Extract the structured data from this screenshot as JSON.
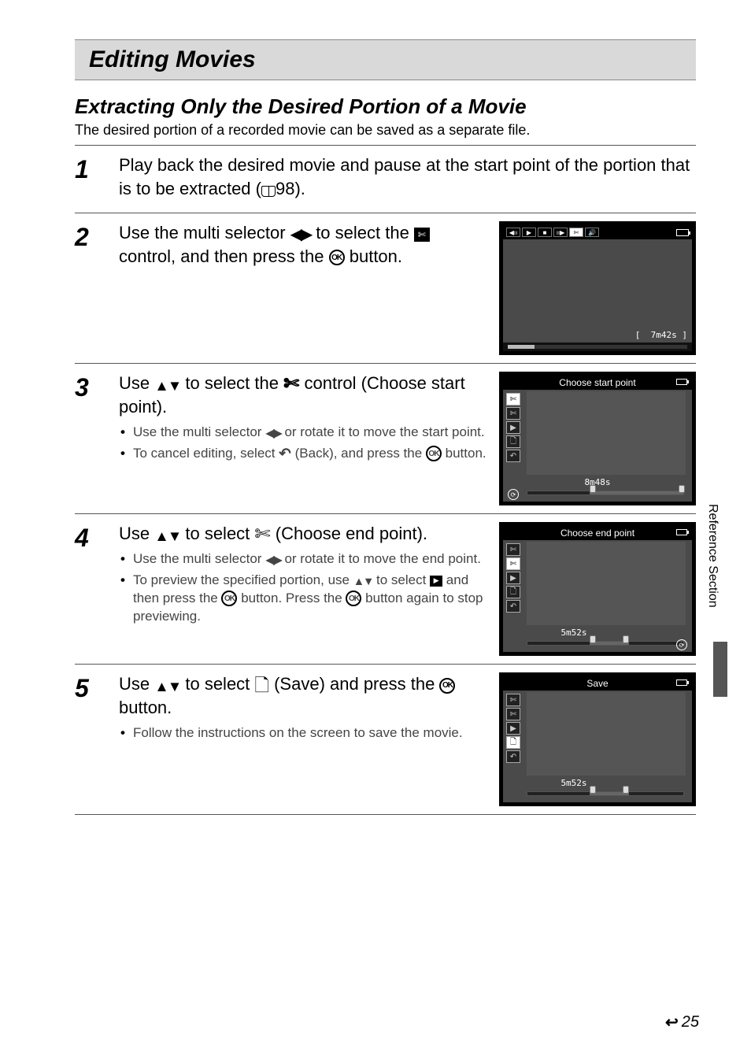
{
  "title": "Editing Movies",
  "subtitle": "Extracting Only the Desired Portion of a Movie",
  "intro": "The desired portion of a recorded movie can be saved as a separate file.",
  "side_label": "Reference Section",
  "page_number": "25",
  "steps": {
    "s1": {
      "num": "1",
      "heading_a": "Play back the desired movie and pause at the start point of the portion that is to be extracted (",
      "heading_b": "98)."
    },
    "s2": {
      "num": "2",
      "heading_a": "Use the multi selector ",
      "heading_b": " to select the ",
      "heading_c": " control, and then press the ",
      "heading_d": " button.",
      "screen_time": "7m42s"
    },
    "s3": {
      "num": "3",
      "heading_a": "Use ",
      "heading_b": " to select the ",
      "heading_c": " control (Choose start point).",
      "bullet1_a": "Use the multi selector ",
      "bullet1_b": " or rotate it to move the start point.",
      "bullet2_a": "To cancel editing, select ",
      "bullet2_b": " (Back), and press the ",
      "bullet2_c": " button.",
      "screen_title": "Choose start point",
      "screen_time": "8m48s"
    },
    "s4": {
      "num": "4",
      "heading_a": "Use ",
      "heading_b": " to select ",
      "heading_c": " (Choose end point).",
      "bullet1_a": "Use the multi selector ",
      "bullet1_b": " or rotate it to move the end point.",
      "bullet2_a": "To preview the specified portion, use ",
      "bullet2_b": " to select ",
      "bullet2_c": " and then press the ",
      "bullet2_d": " button. Press the ",
      "bullet2_e": " button again to stop previewing.",
      "screen_title": "Choose end point",
      "screen_time": "5m52s"
    },
    "s5": {
      "num": "5",
      "heading_a": "Use ",
      "heading_b": " to select ",
      "heading_c": " (Save) and press the ",
      "heading_d": " button.",
      "bullet1": "Follow the instructions on the screen to save the movie.",
      "screen_title": "Save",
      "screen_time": "5m52s"
    }
  }
}
